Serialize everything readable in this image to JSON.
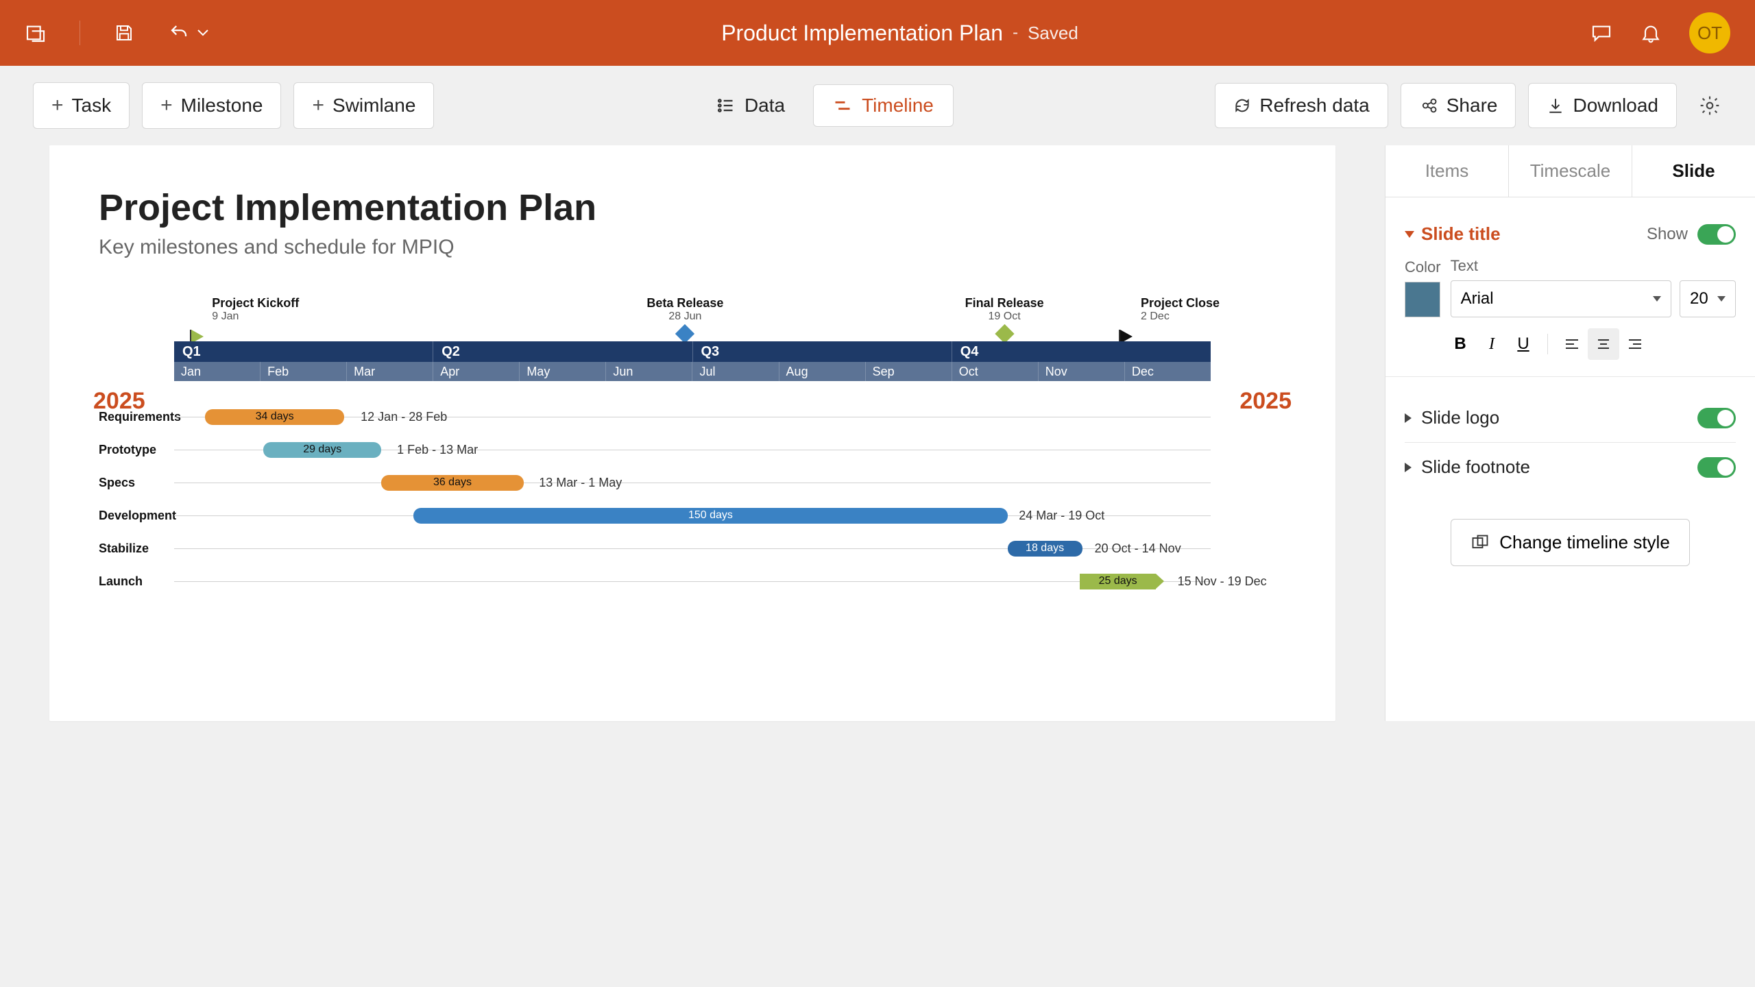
{
  "header": {
    "title": "Product Implementation Plan",
    "status": "Saved",
    "avatar": "OT"
  },
  "toolbar": {
    "task": "Task",
    "milestone": "Milestone",
    "swimlane": "Swimlane",
    "data": "Data",
    "timeline": "Timeline",
    "refresh": "Refresh data",
    "share": "Share",
    "download": "Download"
  },
  "slide": {
    "title": "Project Implementation Plan",
    "subtitle": "Key milestones and schedule for MPIQ",
    "year_left": "2025",
    "year_right": "2025",
    "quarters": [
      "Q1",
      "Q2",
      "Q3",
      "Q4"
    ],
    "months": [
      "Jan",
      "Feb",
      "Mar",
      "Apr",
      "May",
      "Jun",
      "Jul",
      "Aug",
      "Sep",
      "Oct",
      "Nov",
      "Dec"
    ],
    "milestones": [
      {
        "name": "Project Kickoff",
        "date": "9 Jan"
      },
      {
        "name": "Beta Release",
        "date": "28 Jun"
      },
      {
        "name": "Final Release",
        "date": "19 Oct"
      },
      {
        "name": "Project Close",
        "date": "2 Dec"
      }
    ],
    "tasks": [
      {
        "name": "Requirements",
        "duration": "34 days",
        "dates": "12 Jan - 28 Feb"
      },
      {
        "name": "Prototype",
        "duration": "29 days",
        "dates": "1 Feb - 13 Mar"
      },
      {
        "name": "Specs",
        "duration": "36 days",
        "dates": "13 Mar - 1 May"
      },
      {
        "name": "Development",
        "duration": "150 days",
        "dates": "24 Mar - 19 Oct"
      },
      {
        "name": "Stabilize",
        "duration": "18 days",
        "dates": "20 Oct - 14 Nov"
      },
      {
        "name": "Launch",
        "duration": "25 days",
        "dates": "15 Nov - 19 Dec"
      }
    ]
  },
  "panel": {
    "tabs": {
      "items": "Items",
      "timescale": "Timescale",
      "slide": "Slide"
    },
    "slide_title_section": "Slide title",
    "show": "Show",
    "color_label": "Color",
    "text_label": "Text",
    "font": "Arial",
    "font_size": "20",
    "slide_logo": "Slide logo",
    "slide_footnote": "Slide footnote",
    "change_style": "Change timeline style"
  }
}
